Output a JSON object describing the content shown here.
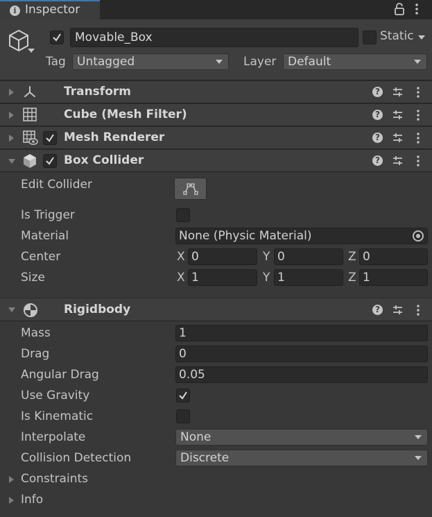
{
  "tab": {
    "title": "Inspector"
  },
  "object": {
    "active": true,
    "name": "Movable_Box",
    "static_label": "Static",
    "tag_label": "Tag",
    "tag_value": "Untagged",
    "layer_label": "Layer",
    "layer_value": "Default"
  },
  "components": {
    "transform": {
      "title": "Transform",
      "expanded": false
    },
    "mesh_filter": {
      "title": "Cube (Mesh Filter)",
      "expanded": false
    },
    "mesh_renderer": {
      "title": "Mesh Renderer",
      "expanded": false,
      "enabled": true
    },
    "box_collider": {
      "title": "Box Collider",
      "expanded": true,
      "enabled": true,
      "edit_collider_label": "Edit Collider",
      "is_trigger_label": "Is Trigger",
      "is_trigger": false,
      "material_label": "Material",
      "material_value": "None (Physic Material)",
      "center_label": "Center",
      "center": {
        "x": "0",
        "y": "0",
        "z": "0"
      },
      "size_label": "Size",
      "size": {
        "x": "1",
        "y": "1",
        "z": "1"
      },
      "axis_labels": {
        "x": "X",
        "y": "Y",
        "z": "Z"
      }
    },
    "rigidbody": {
      "title": "Rigidbody",
      "expanded": true,
      "mass_label": "Mass",
      "mass": "1",
      "drag_label": "Drag",
      "drag": "0",
      "angular_drag_label": "Angular Drag",
      "angular_drag": "0.05",
      "use_gravity_label": "Use Gravity",
      "use_gravity": true,
      "is_kinematic_label": "Is Kinematic",
      "is_kinematic": false,
      "interpolate_label": "Interpolate",
      "interpolate": "None",
      "collision_detection_label": "Collision Detection",
      "collision_detection": "Discrete",
      "constraints_label": "Constraints",
      "info_label": "Info"
    }
  },
  "icons": {
    "tab": "info-icon",
    "lock": "lock-icon",
    "menu": "kebab-menu-icon",
    "object": "cube-outline-icon",
    "help": "help-icon",
    "presets": "sliders-icon",
    "transform": "transform-axes-icon",
    "mesh_filter": "grid-icon",
    "mesh_renderer": "grid-eye-icon",
    "box_collider": "cube-solid-icon",
    "rigidbody": "rigidbody-circle-icon",
    "edit_collider": "edit-collider-icon",
    "object_picker": "object-picker-icon"
  },
  "colors": {
    "background": "#383838",
    "header": "#3e3e3e",
    "field": "#2a2a2a",
    "accent": "#3a79bb"
  }
}
